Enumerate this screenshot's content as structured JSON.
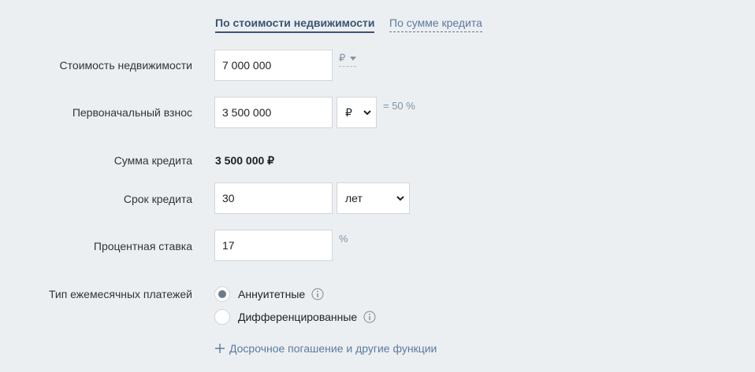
{
  "tabs": {
    "by_property_cost": "По стоимости недвижимости",
    "by_loan_amount": "По сумме кредита"
  },
  "property_cost": {
    "label": "Стоимость недвижимости",
    "value": "7 000 000",
    "currency": "₽"
  },
  "down_payment": {
    "label": "Первоначальный взнос",
    "value": "3 500 000",
    "unit_selected": "₽",
    "percent_text": "= 50 %"
  },
  "loan_amount": {
    "label": "Сумма кредита",
    "value": "3 500 000 ₽"
  },
  "loan_term": {
    "label": "Срок кредита",
    "value": "30",
    "unit_selected": "лет"
  },
  "interest_rate": {
    "label": "Процентная ставка",
    "value": "17",
    "unit": "%"
  },
  "payment_type": {
    "label": "Тип ежемесячных платежей",
    "options": [
      {
        "label": "Аннуитетные",
        "checked": true
      },
      {
        "label": "Дифференцированные",
        "checked": false
      }
    ]
  },
  "more_link": "Досрочное погашение и другие функции",
  "colors": {
    "background": "#eceff1",
    "accent": "#3a5474",
    "link": "#5c7aa0"
  }
}
